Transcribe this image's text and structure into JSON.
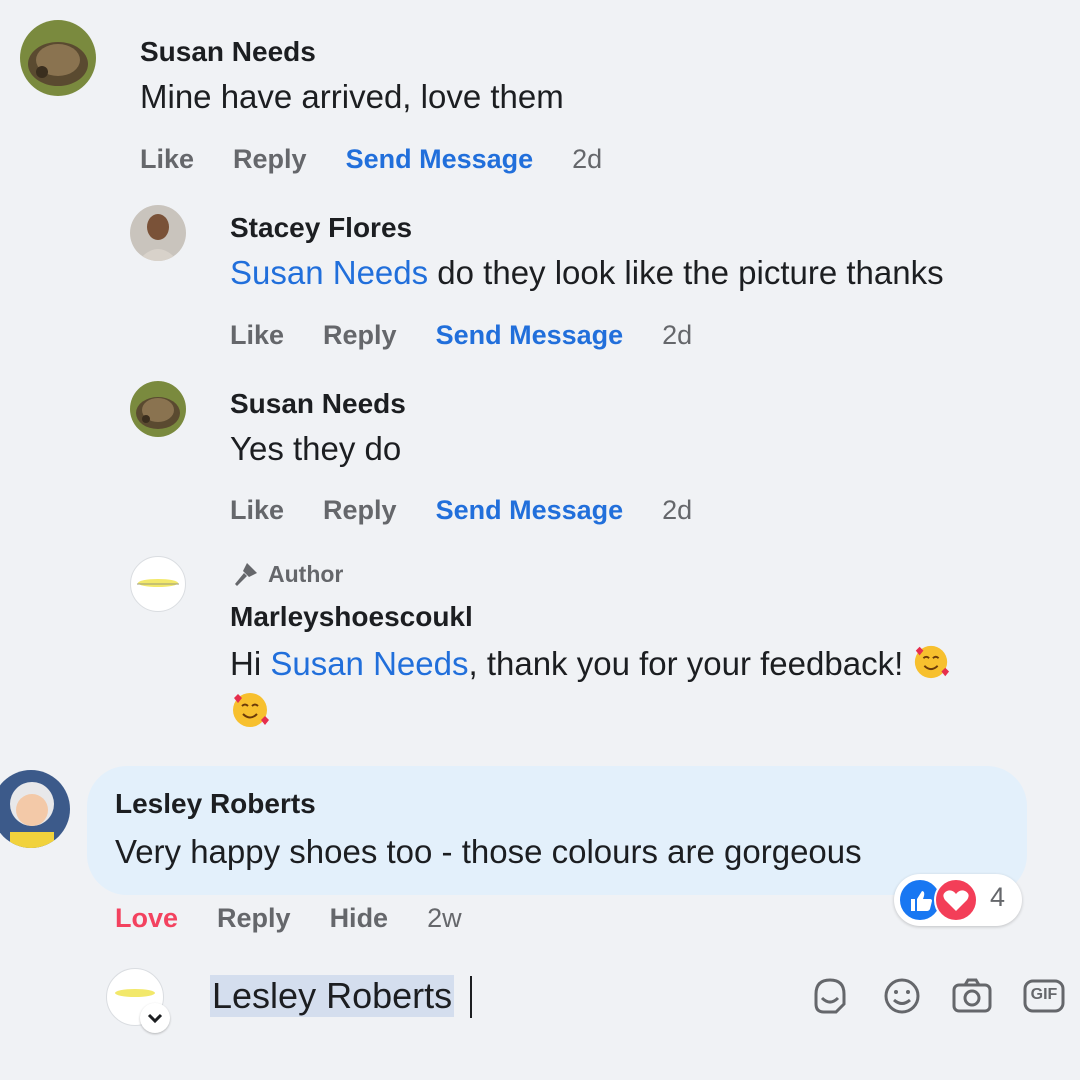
{
  "comments": [
    {
      "author": "Susan Needs",
      "text": "Mine have arrived, love them",
      "actions": {
        "like": "Like",
        "reply": "Reply",
        "send": "Send Message",
        "time": "2d"
      }
    },
    {
      "author": "Stacey Flores",
      "mention": "Susan Needs",
      "text": " do they look like the picture thanks",
      "actions": {
        "like": "Like",
        "reply": "Reply",
        "send": "Send Message",
        "time": "2d"
      }
    },
    {
      "author": "Susan Needs",
      "text": "Yes they do",
      "actions": {
        "like": "Like",
        "reply": "Reply",
        "send": "Send Message",
        "time": "2d"
      }
    },
    {
      "badge": "Author",
      "author": "Marleyshoescoukl",
      "prefix": "Hi ",
      "mention": "Susan Needs",
      "text": ", thank you for your feedback! ",
      "emoji": "smiling-face-with-hearts-emoji"
    },
    {
      "author": "Lesley Roberts",
      "text": "Very happy shoes too - those colours are gorgeous",
      "actions": {
        "love": "Love",
        "reply": "Reply",
        "hide": "Hide",
        "time": "2w"
      },
      "reaction_count": "4"
    }
  ],
  "composer": {
    "value": "Lesley Roberts",
    "icons": [
      "sticker-icon",
      "emoji-icon",
      "camera-icon",
      "gif-icon"
    ],
    "gif_label": "GIF"
  },
  "colors": {
    "link": "#216fdb",
    "love": "#f3425f",
    "like_reaction": "#1877f2",
    "love_reaction": "#f33e58"
  }
}
